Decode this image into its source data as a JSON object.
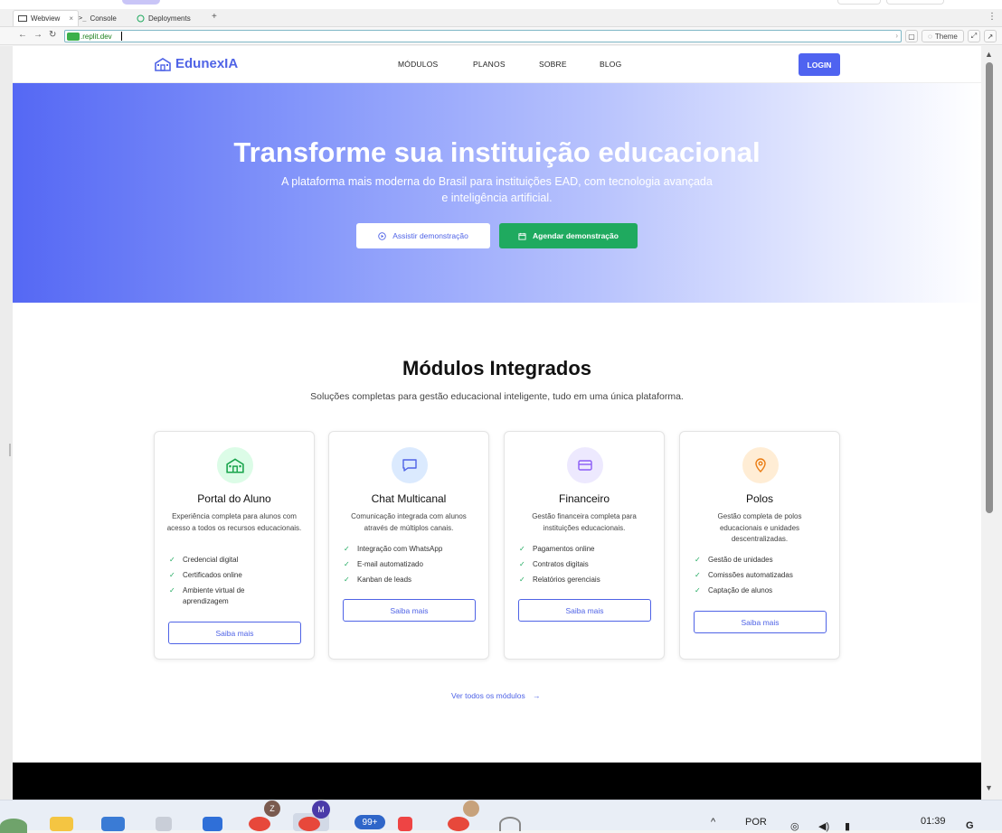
{
  "browser": {
    "tabs": [
      {
        "label": "Webview",
        "icon": "monitor-icon",
        "active": true
      },
      {
        "label": "Console",
        "icon": "terminal-icon",
        "active": false
      },
      {
        "label": "Deployments",
        "icon": "deploy-icon",
        "active": false
      }
    ],
    "tab_close": "×",
    "new_tab": "+",
    "more": "⋮",
    "url_domain": ".replit.dev",
    "theme_label": "Theme"
  },
  "site": {
    "logo_text": "EdunexIA",
    "nav": [
      "MÓDULOS",
      "PLANOS",
      "SOBRE",
      "BLOG"
    ],
    "login_label": "LOGIN",
    "brand_color": "#4f63f0"
  },
  "hero": {
    "title": "Transforme sua instituição educacional",
    "subtitle_line1": "A plataforma mais moderna do Brasil para instituições EAD, com tecnologia avançada",
    "subtitle_line2": "e inteligência artificial.",
    "watch_demo": "Assistir demonstração",
    "schedule_demo": "Agendar demonstração"
  },
  "modules": {
    "title": "Módulos Integrados",
    "subtitle": "Soluções completas para gestão educacional inteligente, tudo em uma única plataforma.",
    "cards": [
      {
        "title": "Portal do Aluno",
        "description": "Experiência completa para alunos com acesso a todos os recursos educacionais.",
        "features": [
          "Credencial digital",
          "Certificados online",
          "Ambiente virtual de aprendizagem"
        ],
        "icon": "school-icon",
        "icon_bg": "#dcfce7",
        "icon_color": "#16a34a",
        "button": "Saiba mais"
      },
      {
        "title": "Chat Multicanal",
        "description": "Comunicação integrada com alunos através de múltiplos canais.",
        "features": [
          "Integração com WhatsApp",
          "E-mail automatizado",
          "Kanban de leads"
        ],
        "icon": "chat-icon",
        "icon_bg": "#dbeafe",
        "icon_color": "#4f63e6",
        "button": "Saiba mais"
      },
      {
        "title": "Financeiro",
        "description": "Gestão financeira completa para instituições educacionais.",
        "features": [
          "Pagamentos online",
          "Contratos digitais",
          "Relatórios gerenciais"
        ],
        "icon": "credit-card-icon",
        "icon_bg": "#ede9fe",
        "icon_color": "#8b5cf6",
        "button": "Saiba mais"
      },
      {
        "title": "Polos",
        "description": "Gestão completa de polos educacionais e unidades descentralizadas.",
        "features": [
          "Gestão de unidades",
          "Comissões automatizadas",
          "Captação de alunos"
        ],
        "icon": "map-pin-icon",
        "icon_bg": "#ffedd5",
        "icon_color": "#ea7c12",
        "button": "Saiba mais"
      }
    ],
    "view_all": "Ver todos os módulos",
    "view_all_arrow": "→",
    "check": "✓"
  },
  "taskbar": {
    "language": "POR",
    "time": "01:39",
    "badge_z": "Z",
    "badge_m": "M",
    "badge_count": "99+"
  }
}
